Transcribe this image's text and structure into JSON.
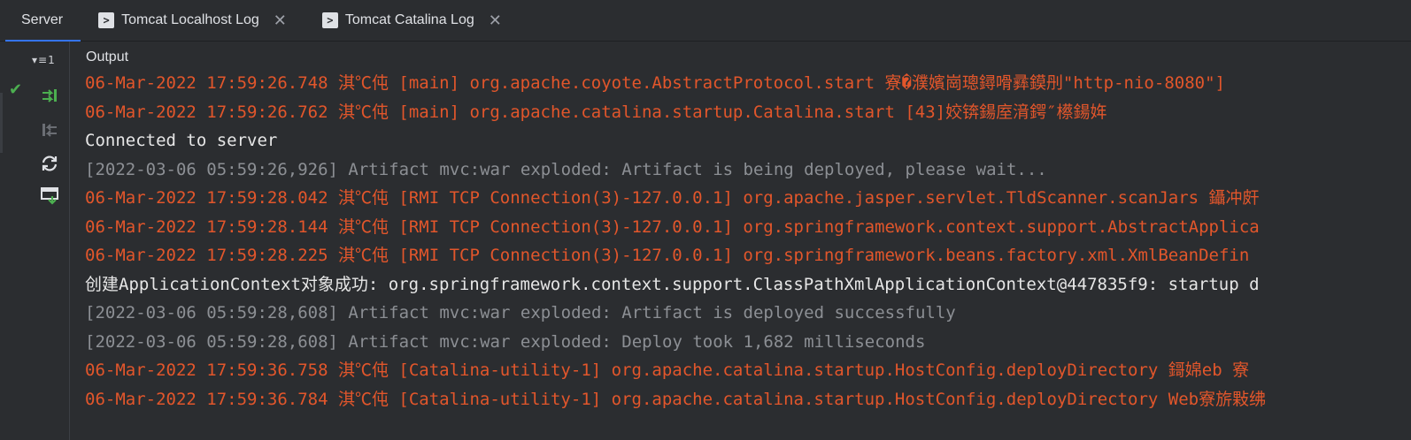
{
  "tabs": [
    {
      "label": "Server",
      "active": true,
      "icon": null
    },
    {
      "label": "Tomcat Localhost Log",
      "active": false,
      "icon": "terminal-icon"
    },
    {
      "label": "Tomcat Catalina Log",
      "active": false,
      "icon": "terminal-icon"
    }
  ],
  "toolbar": {
    "tree_toggle_count": "1",
    "output_label": "Output",
    "deploy_status_icon": "check-icon",
    "icons": [
      "deploy-all-icon",
      "undeploy-icon",
      "refresh-icon",
      "update-icon"
    ]
  },
  "colors": {
    "error": "#e2562b",
    "stdout": "#e6e6e6",
    "system": "#8c8f94",
    "accent": "#3574f0",
    "success": "#4caf50"
  },
  "console": {
    "lines": [
      {
        "type": "err",
        "text": "06-Mar-2022 17:59:26.748 淇℃伅 [main] org.apache.coyote.AbstractProtocol.start 寮�濮嬪崗璁鐞嗗彞鏌刐\"http-nio-8080\"]"
      },
      {
        "type": "err",
        "text": "06-Mar-2022 17:59:26.762 淇℃伅 [main] org.apache.catalina.startup.Catalina.start [43]姣锛鍚庢湇鍔″櫒鍚姩"
      },
      {
        "type": "out",
        "text": "Connected to server"
      },
      {
        "type": "sys",
        "text": "[2022-03-06 05:59:26,926] Artifact mvc:war exploded: Artifact is being deployed, please wait..."
      },
      {
        "type": "err",
        "text": "06-Mar-2022 17:59:28.042 淇℃伅 [RMI TCP Connection(3)-127.0.0.1] org.apache.jasper.servlet.TldScanner.scanJars 鑷冲皯"
      },
      {
        "type": "err",
        "text": "06-Mar-2022 17:59:28.144 淇℃伅 [RMI TCP Connection(3)-127.0.0.1] org.springframework.context.support.AbstractApplica"
      },
      {
        "type": "err",
        "text": "06-Mar-2022 17:59:28.225 淇℃伅 [RMI TCP Connection(3)-127.0.0.1] org.springframework.beans.factory.xml.XmlBeanDefin"
      },
      {
        "type": "out",
        "text": "创建ApplicationContext对象成功: org.springframework.context.support.ClassPathXmlApplicationContext@447835f9: startup d"
      },
      {
        "type": "sys",
        "text": "[2022-03-06 05:59:28,608] Artifact mvc:war exploded: Artifact is deployed successfully"
      },
      {
        "type": "sys",
        "text": "[2022-03-06 05:59:28,608] Artifact mvc:war exploded: Deploy took 1,682 milliseconds"
      },
      {
        "type": "err",
        "text": "06-Mar-2022 17:59:36.758 淇℃伅 [Catalina-utility-1] org.apache.catalina.startup.HostConfig.deployDirectory 鎶婂eb 寮"
      },
      {
        "type": "err",
        "text": "06-Mar-2022 17:59:36.784 淇℃伅 [Catalina-utility-1] org.apache.catalina.startup.HostConfig.deployDirectory Web寮旂敤绋"
      }
    ]
  }
}
